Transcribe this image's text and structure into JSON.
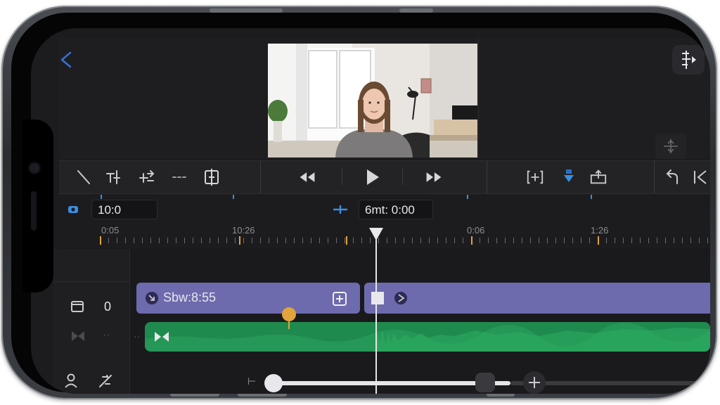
{
  "timecode": {
    "left_value": "10:0",
    "center_value": "6mt: 0:00"
  },
  "ruler": {
    "labels": [
      "0:05",
      "10:26",
      "0:06",
      "1:26"
    ]
  },
  "clips": {
    "video_clip_label": "Sbw:8:55"
  },
  "tracks": {
    "video_track_count": "0"
  },
  "icons": {
    "back": "chevron-left-icon",
    "rewind": "rewind-icon",
    "play": "play-icon",
    "fast_forward": "fast-forward-icon",
    "undo": "undo-icon"
  },
  "colors": {
    "accent_blue": "#3a8ee6",
    "clip_purple": "#6d6aae",
    "audio_green": "#1f8a4e",
    "marker_orange": "#e0a43a"
  },
  "playback": {
    "scrubber_position_fraction": 0.0
  }
}
